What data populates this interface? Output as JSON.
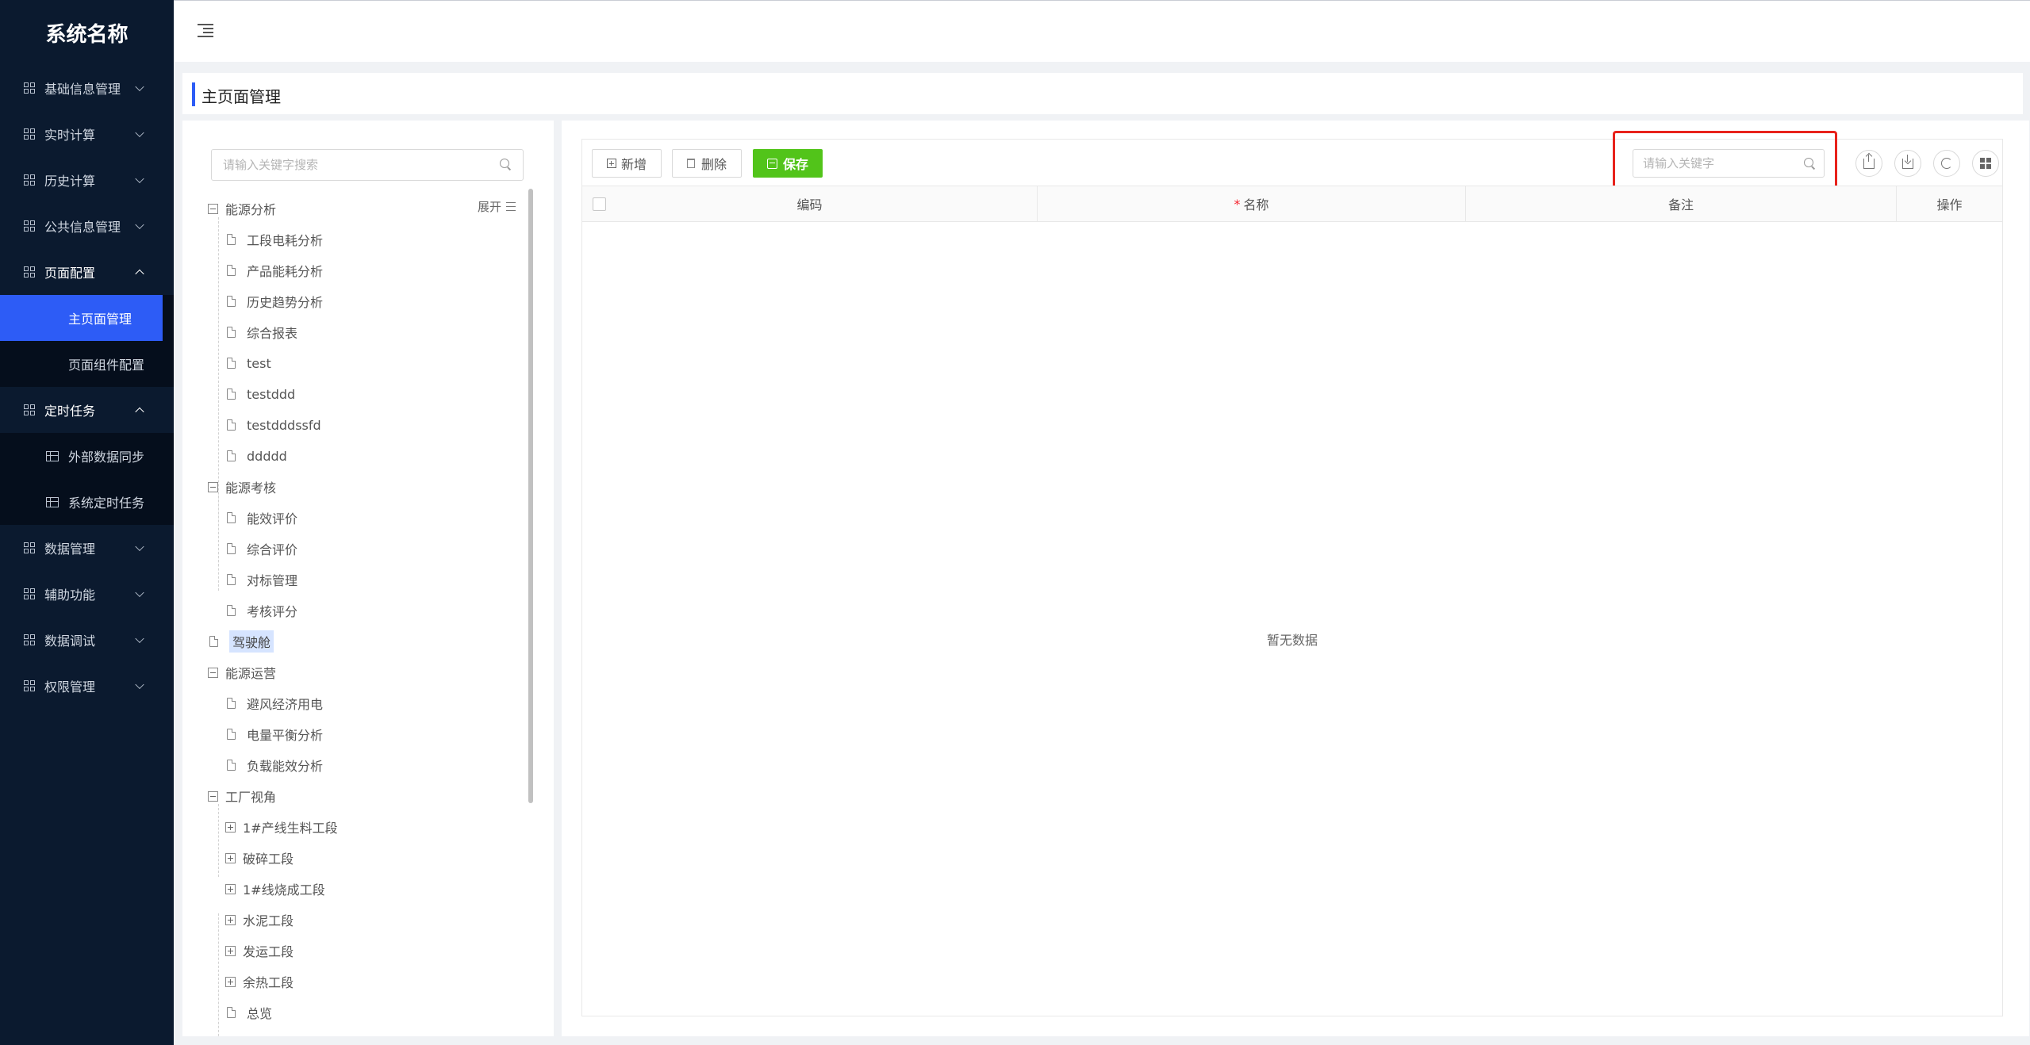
{
  "app": {
    "title": "系统名称"
  },
  "sidebar": {
    "items": [
      {
        "label": "基础信息管理"
      },
      {
        "label": "实时计算"
      },
      {
        "label": "历史计算"
      },
      {
        "label": "公共信息管理"
      },
      {
        "label": "页面配置",
        "children": [
          {
            "label": "主页面管理"
          },
          {
            "label": "页面组件配置"
          }
        ]
      },
      {
        "label": "定时任务",
        "children": [
          {
            "label": "外部数据同步"
          },
          {
            "label": "系统定时任务"
          }
        ]
      },
      {
        "label": "数据管理"
      },
      {
        "label": "辅助功能"
      },
      {
        "label": "数据调试"
      },
      {
        "label": "权限管理"
      }
    ]
  },
  "page": {
    "title": "主页面管理"
  },
  "tree": {
    "search_placeholder": "请输入关键字搜索",
    "expand_label": "展开",
    "nodes": [
      {
        "label": "能源分析"
      },
      {
        "label": "工段电耗分析"
      },
      {
        "label": "产品能耗分析"
      },
      {
        "label": "历史趋势分析"
      },
      {
        "label": "综合报表"
      },
      {
        "label": "test"
      },
      {
        "label": "testddd"
      },
      {
        "label": "testdddssfd"
      },
      {
        "label": "ddddd"
      },
      {
        "label": "能源考核"
      },
      {
        "label": "能效评价"
      },
      {
        "label": "综合评价"
      },
      {
        "label": "对标管理"
      },
      {
        "label": "考核评分"
      },
      {
        "label": "驾驶舱"
      },
      {
        "label": "能源运营"
      },
      {
        "label": "避风经济用电"
      },
      {
        "label": "电量平衡分析"
      },
      {
        "label": "负载能效分析"
      },
      {
        "label": "工厂视角"
      },
      {
        "label": "1#产线生料工段"
      },
      {
        "label": "破碎工段"
      },
      {
        "label": "1#线烧成工段"
      },
      {
        "label": "水泥工段"
      },
      {
        "label": "发运工段"
      },
      {
        "label": "余热工段"
      },
      {
        "label": "总览"
      }
    ]
  },
  "toolbar": {
    "add_label": "新增",
    "delete_label": "删除",
    "save_label": "保存",
    "keyword_placeholder": "请输入关键字"
  },
  "table": {
    "columns": [
      "编码",
      "名称",
      "备注",
      "操作"
    ],
    "required_mark": "*",
    "empty_text": "暂无数据"
  },
  "colors": {
    "sidebar_bg": "#0b1a2f",
    "active": "#2d5cf6",
    "save": "#52c41a",
    "highlight": "#e8221b"
  }
}
